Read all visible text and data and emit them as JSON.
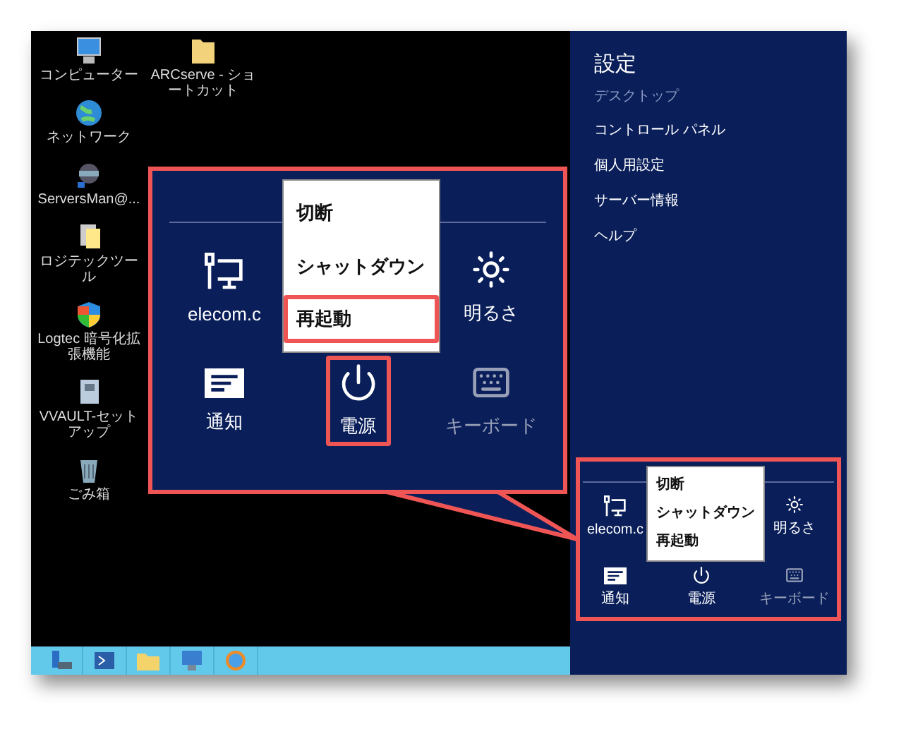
{
  "desktop": {
    "columns": [
      [
        {
          "label": "コンピューター",
          "kind": "computer"
        },
        {
          "label": "ネットワーク",
          "kind": "globe"
        },
        {
          "label": "ServersMan@...",
          "kind": "app"
        },
        {
          "label": "ロジテックツール",
          "kind": "documents"
        },
        {
          "label": "Logtec 暗号化拡張機能",
          "kind": "shield"
        },
        {
          "label": "VVAULT-セットアップ",
          "kind": "installer"
        },
        {
          "label": "ごみ箱",
          "kind": "trash"
        }
      ],
      [
        {
          "label": "ARCserve - ショートカット",
          "kind": "folder"
        }
      ]
    ]
  },
  "callout": {
    "tiles": [
      {
        "label": "elecom.c",
        "kind": "network",
        "highlighted": false,
        "disabled": false
      },
      {
        "label": "明るさ",
        "kind": "brightness",
        "highlighted": false,
        "disabled": false
      },
      {
        "label": "通知",
        "kind": "notifications",
        "highlighted": false,
        "disabled": false
      },
      {
        "label": "電源",
        "kind": "power",
        "highlighted": true,
        "disabled": false
      },
      {
        "label": "キーボード",
        "kind": "keyboard",
        "highlighted": false,
        "disabled": true
      }
    ],
    "menu": [
      {
        "label": "切断",
        "highlighted": false
      },
      {
        "label": "シャットダウン",
        "highlighted": false
      },
      {
        "label": "再起動",
        "highlighted": true
      }
    ]
  },
  "charms": {
    "title": "設定",
    "subtitle": "デスクトップ",
    "links": [
      "コントロール パネル",
      "個人用設定",
      "サーバー情報",
      "ヘルプ"
    ],
    "quick_settings": {
      "tiles": [
        {
          "label": "elecom.c",
          "kind": "network",
          "highlighted": false,
          "disabled": false
        },
        {
          "label": "明るさ",
          "kind": "brightness",
          "highlighted": false,
          "disabled": false
        },
        {
          "label": "通知",
          "kind": "notifications",
          "highlighted": false,
          "disabled": false
        },
        {
          "label": "電源",
          "kind": "power",
          "highlighted": false,
          "disabled": false
        },
        {
          "label": "キーボード",
          "kind": "keyboard",
          "highlighted": false,
          "disabled": true
        }
      ],
      "menu": [
        {
          "label": "切断",
          "highlighted": false
        },
        {
          "label": "シャットダウン",
          "highlighted": false
        },
        {
          "label": "再起動",
          "highlighted": false
        }
      ]
    }
  }
}
